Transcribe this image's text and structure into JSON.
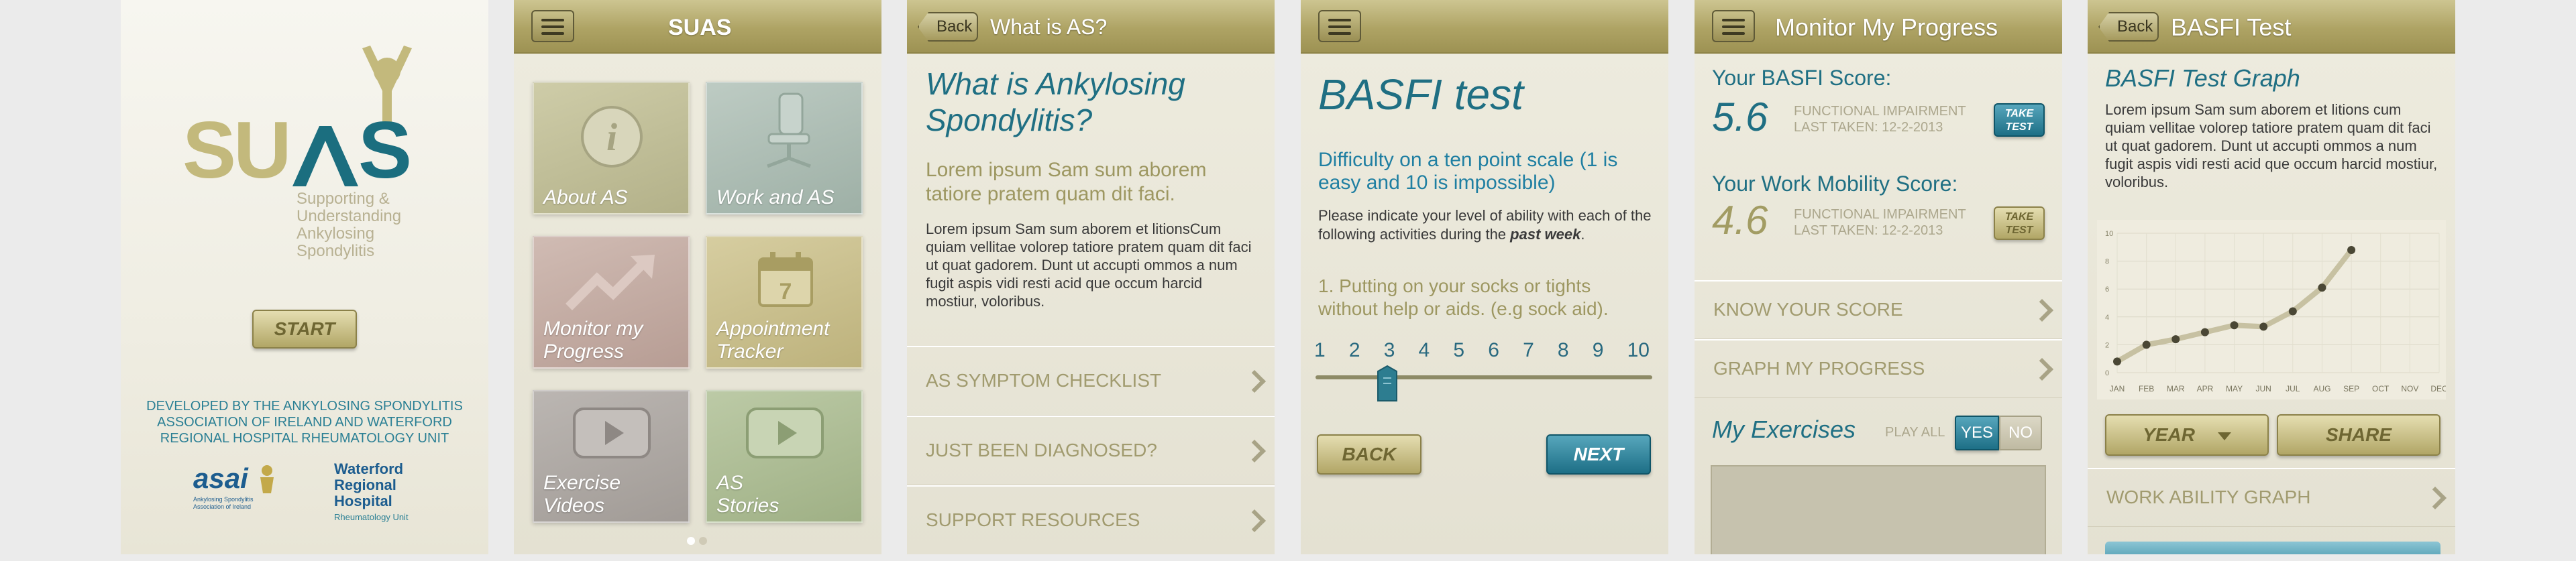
{
  "splash": {
    "logo_top": "SU",
    "logo_bottom": "AS",
    "tagline": [
      "Supporting &",
      "Understanding",
      "Ankylosing",
      "Spondylitis"
    ],
    "start_label": "START",
    "developed_by": [
      "DEVELOPED BY THE ANKYLOSING SPONDYLITIS",
      "ASSOCIATION OF IRELAND AND WATERFORD",
      "REGIONAL HOSPITAL RHEUMATOLOGY UNIT"
    ],
    "asai_logo": "asai",
    "asai_sub": [
      "Ankylosing Spondylitis",
      "Association of Ireland"
    ],
    "hospital_name": [
      "Waterford",
      "Regional",
      "Hospital"
    ],
    "hospital_unit": "Rheumatology Unit"
  },
  "home": {
    "bar_logo": "SUAS",
    "tiles": [
      {
        "label": "About AS",
        "icon": "info-icon",
        "color": "#bdbb92"
      },
      {
        "label": "Work and AS",
        "icon": "office-chair-icon",
        "color": "#a9bab0"
      },
      {
        "label": "Monitor my Progress",
        "icon": "trend-arrow-icon",
        "color": "#c2a9a1"
      },
      {
        "label": "Appointment Tracker",
        "icon": "calendar-icon",
        "color": "#c8bf8c",
        "calendar_day": "7"
      },
      {
        "label": "Exercise Videos",
        "icon": "play-icon",
        "color": "#ada7a3"
      },
      {
        "label": "AS Stories",
        "icon": "play-icon",
        "color": "#a9bb93"
      }
    ]
  },
  "what_is": {
    "back": "Back",
    "title": "What is AS?",
    "heading": "What is Ankylosing Spondylitis?",
    "lead": "Lorem ipsum Sam sum aborem tatiore pratem quam dit faci.",
    "body": "Lorem ipsum Sam sum aborem et litionsCum quiam vellitae volorep tatiore pratem quam dit faci ut quat gadorem. Dunt ut accupti ommos a num fugit aspis vidi resti acid que occum harcid mostiur, voloribus.",
    "rows": [
      "AS SYMPTOM CHECKLIST",
      "JUST BEEN DIAGNOSED?",
      "SUPPORT RESOURCES"
    ]
  },
  "basfi": {
    "title": "BASFI test",
    "subtitle": "Difficulty on a ten point scale (1 is easy and 10 is impossible)",
    "instr_prefix": "Please indicate your level of ability with each of the following activities during the ",
    "instr_emph": "past week",
    "instr_suffix": ".",
    "question": "1. Putting on your socks or tights without help or aids. (e.g sock aid).",
    "scale": [
      "1",
      "2",
      "3",
      "4",
      "5",
      "6",
      "7",
      "8",
      "9",
      "10"
    ],
    "selected": 3,
    "back_label": "BACK",
    "next_label": "NEXT"
  },
  "monitor": {
    "title": "Monitor My Progress",
    "basfi_label": "Your BASFI Score:",
    "basfi_score": "5.6",
    "basfi_status": "FUNCTIONAL IMPAIRMENT",
    "basfi_last": "LAST TAKEN: 12-2-2013",
    "work_label": "Your Work Mobility Score:",
    "work_score": "4.6",
    "work_status": "FUNCTIONAL IMPAIRMENT",
    "work_last": "LAST TAKEN: 12-2-2013",
    "take_test": "TAKE TEST",
    "rows": [
      "KNOW YOUR SCORE",
      "GRAPH MY PROGRESS"
    ],
    "exercises_label": "My Exercises",
    "play_all": "PLAY ALL",
    "yes": "YES",
    "no": "NO"
  },
  "graph": {
    "back": "Back",
    "title": "BASFI Test",
    "heading": "BASFI Test Graph",
    "body": "Lorem ipsum Sam sum aborem et litions cum quiam vellitae volorep tatiore pratem quam dit faci ut quat gadorem. Dunt ut accupti ommos a num fugit aspis vidi resti acid que occum harcid mostiur, voloribus.",
    "year_label": "YEAR",
    "share_label": "SHARE",
    "work_row": "WORK ABILITY GRAPH"
  },
  "chart_data": {
    "type": "line",
    "categories": [
      "JAN",
      "FEB",
      "MAR",
      "APR",
      "MAY",
      "JUN",
      "JUL",
      "AUG",
      "SEP",
      "OCT",
      "NOV",
      "DEC"
    ],
    "values": [
      0.8,
      2.0,
      2.4,
      2.9,
      3.4,
      3.3,
      4.4,
      6.1,
      8.8,
      null,
      null,
      null
    ],
    "yticks": [
      "10",
      "8",
      "6",
      "4",
      "2",
      "0"
    ],
    "ylim": [
      0,
      10
    ],
    "grid": true
  }
}
